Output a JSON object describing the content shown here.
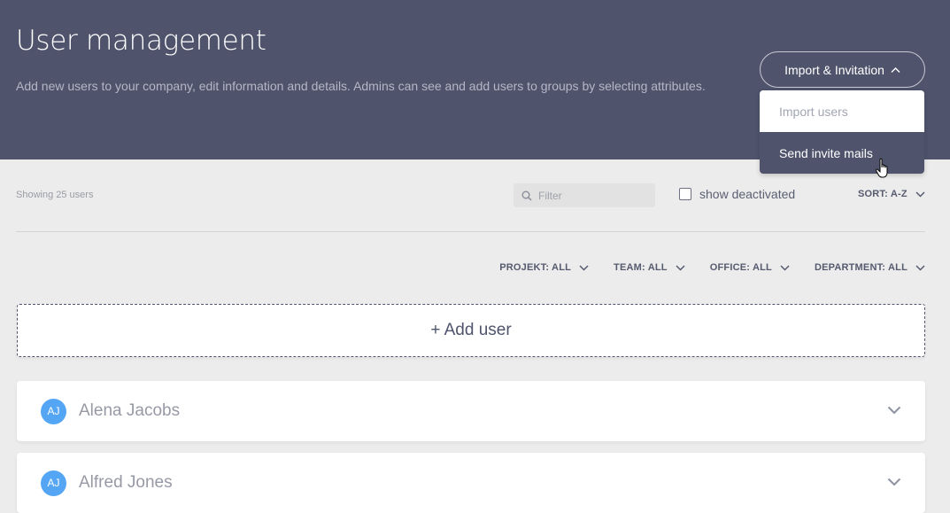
{
  "header": {
    "title": "User management",
    "description": "Add new users to your company, edit information and details. Admins can see and add users to groups by selecting attributes.",
    "import_button_label": "Import & Invitation",
    "dropdown_items": [
      {
        "label": "Import users"
      },
      {
        "label": "Send invite mails"
      }
    ]
  },
  "toolbar": {
    "showing_text": "Showing 25 users",
    "filter_placeholder": "Filter",
    "show_deactivated_label": "show deactivated",
    "show_deactivated_checked": false,
    "sort_label": "SORT: A-Z"
  },
  "filters": [
    {
      "label": "PROJEKT: ALL"
    },
    {
      "label": "TEAM: ALL"
    },
    {
      "label": "OFFICE: ALL"
    },
    {
      "label": "DEPARTMENT: ALL"
    }
  ],
  "add_user_label": "+ Add user",
  "users": [
    {
      "initials": "AJ",
      "name": "Alena Jacobs"
    },
    {
      "initials": "AJ",
      "name": "Alfred Jones"
    }
  ],
  "colors": {
    "header_bg": "#4f546c",
    "avatar_bg": "#54a6f5",
    "page_bg": "#ececec"
  }
}
